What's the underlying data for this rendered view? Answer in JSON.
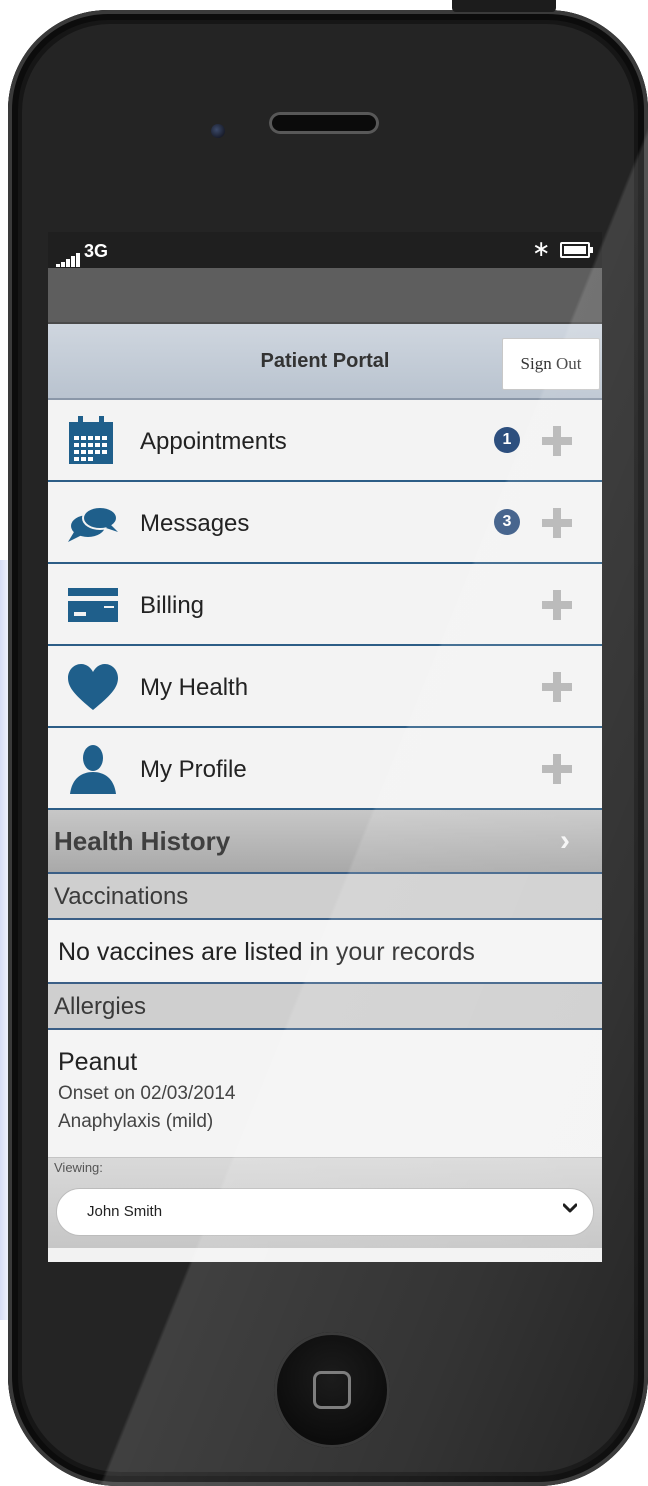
{
  "status_bar": {
    "network": "3G",
    "bluetooth_icon": "bluetooth-icon",
    "battery_icon": "battery-icon"
  },
  "header": {
    "title": "Patient Portal",
    "sign_out_label": "Sign Out"
  },
  "menu": {
    "items": [
      {
        "label": "Appointments",
        "icon": "calendar-icon",
        "badge": "1",
        "action_icon": "plus-icon"
      },
      {
        "label": "Messages",
        "icon": "chat-bubbles-icon",
        "badge": "3",
        "action_icon": "plus-icon"
      },
      {
        "label": "Billing",
        "icon": "credit-card-icon",
        "action_icon": "plus-icon"
      },
      {
        "label": "My Health",
        "icon": "heart-icon",
        "action_icon": "plus-icon"
      },
      {
        "label": "My Profile",
        "icon": "person-icon",
        "action_icon": "plus-icon"
      }
    ]
  },
  "health_history": {
    "title": "Health History",
    "vaccinations": {
      "header": "Vaccinations",
      "empty_text": "No vaccines are listed in your records"
    },
    "allergies": {
      "header": "Allergies",
      "items": [
        {
          "name": "Peanut",
          "onset": "Onset on 02/03/2014",
          "reaction": "Anaphylaxis (mild)"
        }
      ]
    }
  },
  "viewing": {
    "label": "Viewing:",
    "selected": "John Smith"
  },
  "colors": {
    "accent": "#1f5f8b",
    "badge": "#2d4f7e",
    "divider": "#3b5f86"
  }
}
